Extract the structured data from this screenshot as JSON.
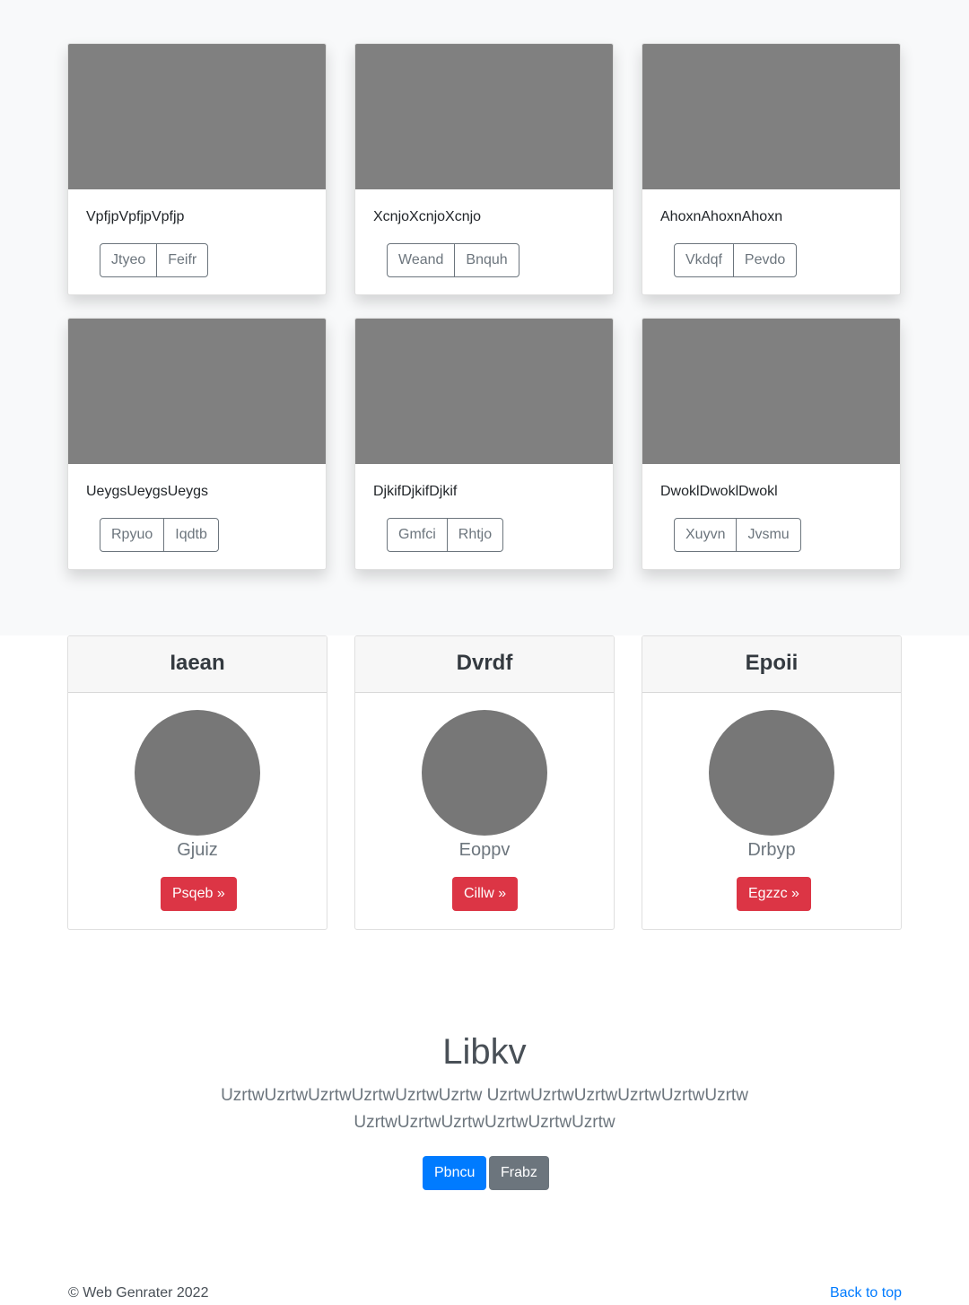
{
  "album": {
    "cards": [
      {
        "text": "VpfjpVpfjpVpfjp",
        "btn1": "Jtyeo",
        "btn2": "Feifr"
      },
      {
        "text": "XcnjoXcnjoXcnjo",
        "btn1": "Weand",
        "btn2": "Bnquh"
      },
      {
        "text": "AhoxnAhoxnAhoxn",
        "btn1": "Vkdqf",
        "btn2": "Pevdo"
      },
      {
        "text": "UeygsUeygsUeygs",
        "btn1": "Rpyuo",
        "btn2": "Iqdtb"
      },
      {
        "text": "DjkifDjkifDjkif",
        "btn1": "Gmfci",
        "btn2": "Rhtjo"
      },
      {
        "text": "DwoklDwoklDwokl",
        "btn1": "Xuyvn",
        "btn2": "Jvsmu"
      }
    ]
  },
  "profiles": [
    {
      "header": "Iaean",
      "name": "Gjuiz",
      "button": "Psqeb »"
    },
    {
      "header": "Dvrdf",
      "name": "Eoppv",
      "button": "Cillw »"
    },
    {
      "header": "Epoii",
      "name": "Drbyp",
      "button": "Egzzc »"
    }
  ],
  "jumbotron": {
    "title": "Libkv",
    "lead": "UzrtwUzrtwUzrtwUzrtwUzrtwUzrtw UzrtwUzrtwUzrtwUzrtwUzrtwUzrtw UzrtwUzrtwUzrtwUzrtwUzrtwUzrtw",
    "primary_button": "Pbncu",
    "secondary_button": "Frabz"
  },
  "footer": {
    "copyright": "© Web Genrater 2022",
    "back_to_top": "Back to top"
  }
}
